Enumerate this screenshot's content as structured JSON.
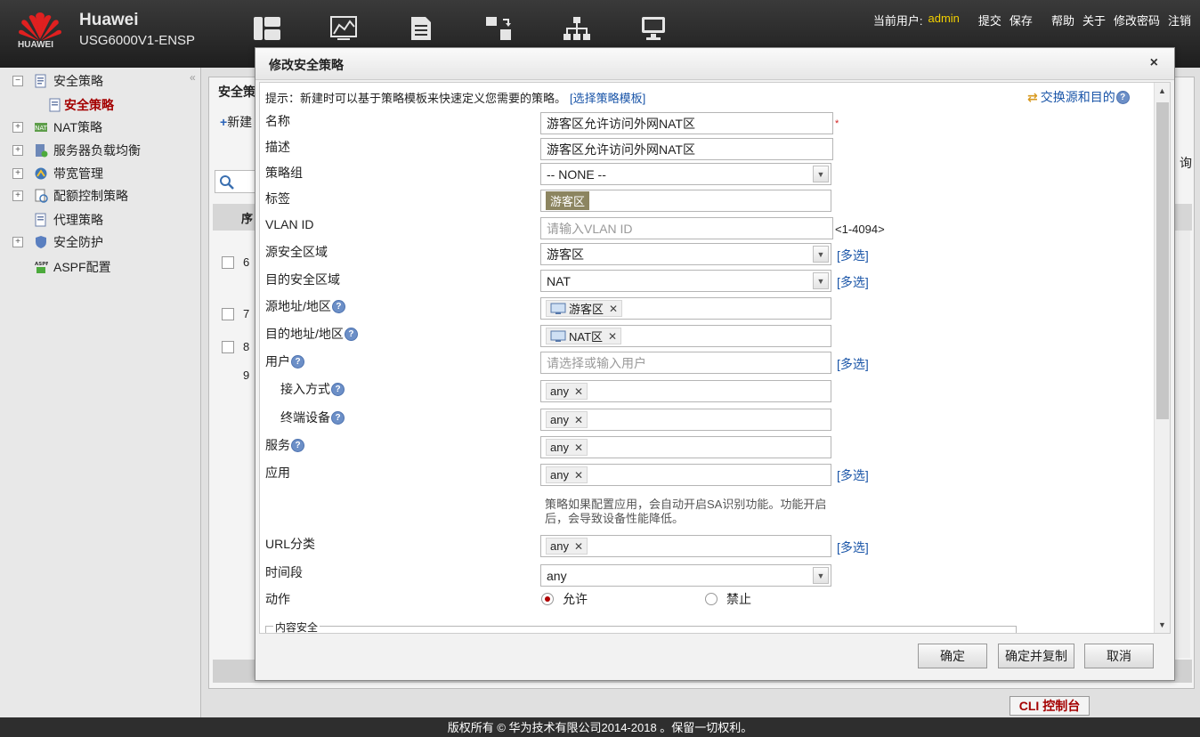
{
  "header": {
    "brand": "Huawei",
    "logo_text": "HUAWEI",
    "model": "USG6000V1-ENSP",
    "current_user_label": "当前用户:",
    "username": "admin",
    "links": [
      "提交",
      "保存",
      "帮助",
      "关于",
      "修改密码",
      "注销"
    ]
  },
  "sidebar": {
    "items": [
      {
        "label": "安全策略",
        "toggle": "−"
      },
      {
        "label": "NAT策略",
        "toggle": "+"
      },
      {
        "label": "服务器负载均衡",
        "toggle": "+"
      },
      {
        "label": "带宽管理",
        "toggle": "+"
      },
      {
        "label": "配额控制策略",
        "toggle": "+"
      },
      {
        "label": "代理策略",
        "toggle": ""
      },
      {
        "label": "安全防护",
        "toggle": "+"
      },
      {
        "label": "ASPF配置",
        "toggle": ""
      }
    ],
    "active_sub": "安全策略",
    "collapse": "«"
  },
  "background": {
    "panel_title": "安全策",
    "new_button": "新建",
    "header_col": "序",
    "rows": [
      "6",
      "7",
      "8",
      "9"
    ],
    "right_text": "询"
  },
  "modal": {
    "title": "修改安全策略",
    "close": "×",
    "tip": "提示：新建时可以基于策略模板来快速定义您需要的策略。",
    "tip_link": "[选择策略模板]",
    "swap_link": "交换源和目的",
    "fields": {
      "name_label": "名称",
      "name_value": "游客区允许访问外网NAT区",
      "desc_label": "描述",
      "desc_value": "游客区允许访问外网NAT区",
      "group_label": "策略组",
      "group_value": "-- NONE --",
      "tag_label": "标签",
      "tag_value": "游客区",
      "vlan_label": "VLAN ID",
      "vlan_placeholder": "请输入VLAN ID",
      "vlan_range": "<1-4094>",
      "src_zone_label": "源安全区域",
      "src_zone_value": "游客区",
      "dst_zone_label": "目的安全区域",
      "dst_zone_value": "NAT",
      "src_addr_label": "源地址/地区",
      "src_addr_value": "游客区",
      "dst_addr_label": "目的地址/地区",
      "dst_addr_value": "NAT区",
      "user_label": "用户",
      "user_placeholder": "请选择或输入用户",
      "access_label": "接入方式",
      "access_value": "any",
      "terminal_label": "终端设备",
      "terminal_value": "any",
      "service_label": "服务",
      "service_value": "any",
      "app_label": "应用",
      "app_value": "any",
      "app_note": "策略如果配置应用，会自动开启SA识别功能。功能开启后，会导致设备性能降低。",
      "url_label": "URL分类",
      "url_value": "any",
      "time_label": "时间段",
      "time_value": "any",
      "action_label": "动作",
      "action_allow": "允许",
      "action_deny": "禁止",
      "content_security": "内容安全"
    },
    "more_link": "[多选]",
    "help_glyph": "?",
    "buttons": {
      "ok": "确定",
      "ok_copy": "确定并复制",
      "cancel": "取消"
    }
  },
  "cli_button": "CLI 控制台",
  "footer": "版权所有 © 华为技术有限公司2014-2018 。保留一切权利。",
  "colors": {
    "accent_red": "#a40000",
    "link_blue": "#1a55a8",
    "admin_yellow": "#f2d000"
  }
}
